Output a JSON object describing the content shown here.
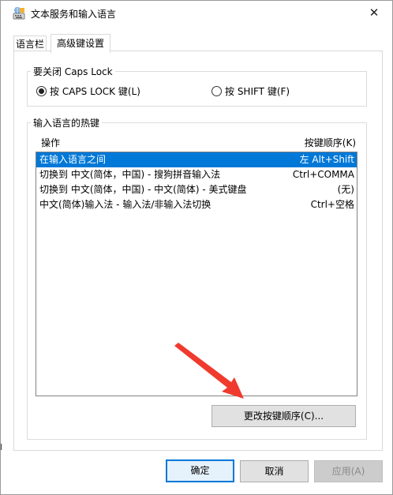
{
  "window": {
    "title": "文本服务和输入语言",
    "close_glyph": "✕",
    "left_edge_glyph": "I"
  },
  "tabs": [
    {
      "label": "语言栏",
      "active": false
    },
    {
      "label": "高级键设置",
      "active": true
    }
  ],
  "caps_group": {
    "legend": "要关闭 Caps Lock",
    "option_caps": "按 CAPS LOCK 键(L)",
    "option_shift": "按 SHIFT 键(F)",
    "selected": "caps"
  },
  "hotkeys_group": {
    "legend": "输入语言的热键",
    "col_action": "操作",
    "col_sequence": "按键顺序(K)",
    "rows": [
      {
        "action": "在输入语言之间",
        "keys": "左 Alt+Shift",
        "selected": true
      },
      {
        "action": "切换到 中文(简体，中国) - 搜狗拼音输入法",
        "keys": "Ctrl+COMMA",
        "selected": false
      },
      {
        "action": "切换到 中文(简体，中国) - 中文(简体) - 美式键盘",
        "keys": "(无)",
        "selected": false
      },
      {
        "action": "中文(简体)输入法 - 输入法/非输入法切换",
        "keys": "Ctrl+空格",
        "selected": false
      }
    ],
    "change_button": "更改按键顺序(C)..."
  },
  "footer": {
    "ok": "确定",
    "cancel": "取消",
    "apply": "应用(A)",
    "apply_enabled": false
  },
  "colors": {
    "accent": "#0078d7",
    "annotation_arrow": "#f03a2e"
  }
}
